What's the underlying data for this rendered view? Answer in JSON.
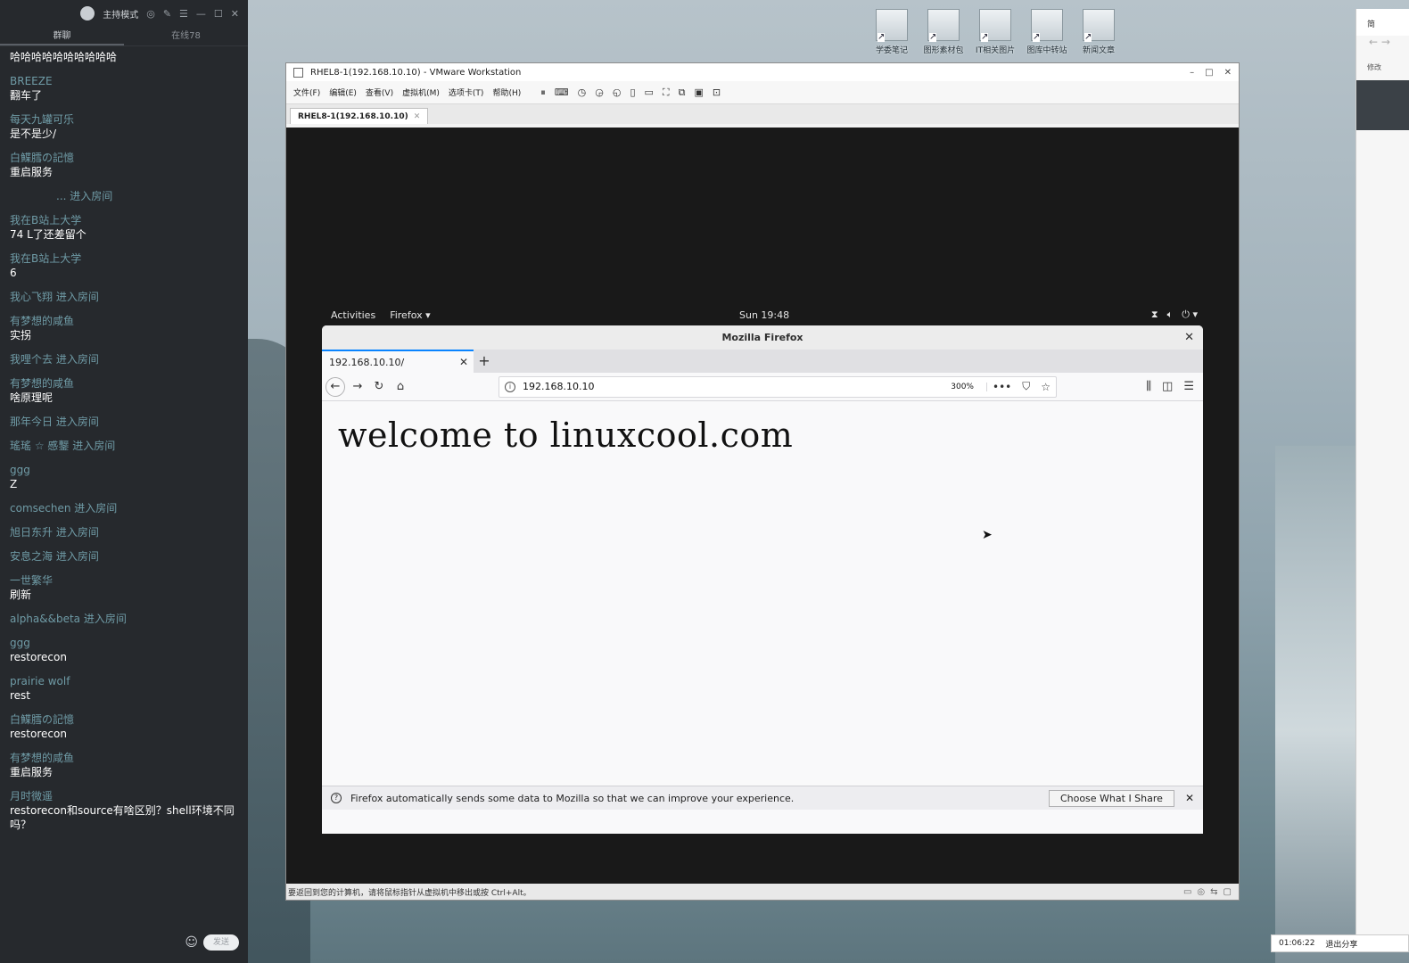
{
  "chat": {
    "header_title": "主持模式",
    "tabs": [
      "群聊",
      "在线78"
    ],
    "messages": [
      {
        "user": "",
        "text": "哈哈哈哈哈哈哈哈哈哈"
      },
      {
        "user": "BREEZE",
        "text": "翻车了"
      },
      {
        "user": "每天九罐可乐",
        "text": "是不是少/"
      },
      {
        "user": "白鰈膤の記憶",
        "text": "重启服务"
      },
      {
        "user": "...",
        "join": "进入房间"
      },
      {
        "user": "我在B站上大学",
        "text": "74 L了还差留个"
      },
      {
        "user": "我在B站上大学",
        "text": "6"
      },
      {
        "user": "我心飞翔",
        "join": "进入房间"
      },
      {
        "user": "有梦想的咸鱼",
        "text": "实拐"
      },
      {
        "user": "我哩个去",
        "join": "进入房间"
      },
      {
        "user": "有梦想的咸鱼",
        "text": "啥原理呢"
      },
      {
        "user": "那年今日",
        "join": "进入房间"
      },
      {
        "user": "瑤瑤 ☆ 慼鑋",
        "join": "进入房间"
      },
      {
        "user": "ggg",
        "text": "Z"
      },
      {
        "user": "comsechen",
        "join": "进入房间"
      },
      {
        "user": "旭日东升",
        "join": "进入房间"
      },
      {
        "user": "安息之海",
        "join": "进入房间"
      },
      {
        "user": "一世繁华",
        "text": "刷新"
      },
      {
        "user": "alpha&&beta",
        "join": "进入房间"
      },
      {
        "user": "ggg",
        "text": "restorecon"
      },
      {
        "user": "prairie wolf",
        "text": "rest"
      },
      {
        "user": "白鰈膤の記憶",
        "text": "restorecon"
      },
      {
        "user": "有梦想的咸鱼",
        "text": "重启服务"
      },
      {
        "user": "月时微遥",
        "text": "restorecon和source有啥区别？shell环境不同吗？"
      }
    ],
    "send_label": "发送"
  },
  "desktop": {
    "icons": [
      "学委笔记",
      "图形素材包",
      "IT相关图片",
      "图库中转站",
      "新闻文章"
    ]
  },
  "vmware": {
    "title": "RHEL8-1(192.168.10.10) - VMware Workstation",
    "menu": [
      "文件(F)",
      "编辑(E)",
      "查看(V)",
      "虚拟机(M)",
      "选项卡(T)",
      "帮助(H)"
    ],
    "tab_label": "RHEL8-1(192.168.10.10)",
    "status_text": "要返回到您的计算机，请将鼠标指针从虚拟机中移出或按 Ctrl+Alt。"
  },
  "gnome": {
    "activities": "Activities",
    "app_menu": "Firefox ▾",
    "clock": "Sun 19:48"
  },
  "firefox": {
    "window_title": "Mozilla Firefox",
    "tab_title": "192.168.10.10/",
    "url": "192.168.10.10",
    "zoom": "300%",
    "page_heading": "welcome to linuxcool.com",
    "notification": "Firefox automatically sends some data to Mozilla so that we can improve your experience.",
    "choose_button": "Choose What I Share"
  },
  "rightwin": {
    "title": "简",
    "row": "修改"
  },
  "sharebar": {
    "timer": "01:06:22",
    "exit_label": "退出分享"
  }
}
